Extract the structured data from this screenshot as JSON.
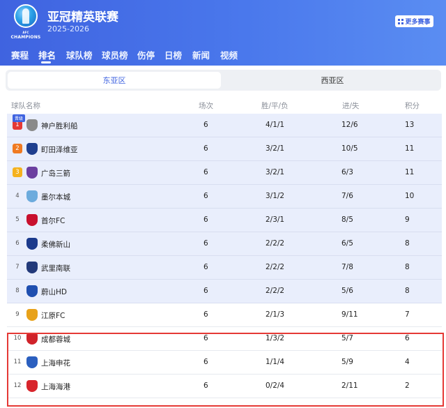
{
  "header": {
    "title": "亚冠精英联赛",
    "season": "2025-2026",
    "logo_text": "CHAMPIONS",
    "logo_small": "AFC",
    "more_label": "更多赛事"
  },
  "nav": [
    {
      "label": "赛程",
      "active": false
    },
    {
      "label": "排名",
      "active": true
    },
    {
      "label": "球队榜",
      "active": false
    },
    {
      "label": "球员榜",
      "active": false
    },
    {
      "label": "伤停",
      "active": false
    },
    {
      "label": "日榜",
      "active": false
    },
    {
      "label": "新闻",
      "active": false
    },
    {
      "label": "视频",
      "active": false
    }
  ],
  "zones": {
    "east": "东亚区",
    "west": "西亚区",
    "active": "east"
  },
  "table": {
    "headers": {
      "team": "球队名称",
      "played": "场次",
      "wdl": "胜/平/负",
      "goals": "进/失",
      "points": "积分"
    },
    "qualified_tag": "晋级",
    "rows": [
      {
        "rank": "1",
        "team": "神户胜利船",
        "played": "6",
        "wdl": "4/1/1",
        "goals": "12/6",
        "points": "13",
        "crest": "#8a8a8a"
      },
      {
        "rank": "2",
        "team": "町田泽维亚",
        "played": "6",
        "wdl": "3/2/1",
        "goals": "10/5",
        "points": "11",
        "crest": "#1f3f8f"
      },
      {
        "rank": "3",
        "team": "广岛三箭",
        "played": "6",
        "wdl": "3/2/1",
        "goals": "6/3",
        "points": "11",
        "crest": "#6b3fa0"
      },
      {
        "rank": "4",
        "team": "墨尔本城",
        "played": "6",
        "wdl": "3/1/2",
        "goals": "7/6",
        "points": "10",
        "crest": "#6cabdd"
      },
      {
        "rank": "5",
        "team": "首尔FC",
        "played": "6",
        "wdl": "2/3/1",
        "goals": "8/5",
        "points": "9",
        "crest": "#c8102e"
      },
      {
        "rank": "6",
        "team": "柔佛新山",
        "played": "6",
        "wdl": "2/2/2",
        "goals": "6/5",
        "points": "8",
        "crest": "#1b3a8c"
      },
      {
        "rank": "7",
        "team": "武里南联",
        "played": "6",
        "wdl": "2/2/2",
        "goals": "7/8",
        "points": "8",
        "crest": "#233a7a"
      },
      {
        "rank": "8",
        "team": "蔚山HD",
        "played": "6",
        "wdl": "2/2/2",
        "goals": "5/6",
        "points": "8",
        "crest": "#1f4fb0"
      },
      {
        "rank": "9",
        "team": "江原FC",
        "played": "6",
        "wdl": "2/1/3",
        "goals": "9/11",
        "points": "7",
        "crest": "#e8a21a"
      },
      {
        "rank": "10",
        "team": "成都蓉城",
        "played": "6",
        "wdl": "1/3/2",
        "goals": "5/7",
        "points": "6",
        "crest": "#d0232a"
      },
      {
        "rank": "11",
        "team": "上海申花",
        "played": "6",
        "wdl": "1/1/4",
        "goals": "5/9",
        "points": "4",
        "crest": "#2b5fbf"
      },
      {
        "rank": "12",
        "team": "上海海港",
        "played": "6",
        "wdl": "0/2/4",
        "goals": "2/11",
        "points": "2",
        "crest": "#d8252c"
      }
    ]
  },
  "colors": {
    "accent": "#3f63e0",
    "qualified_bg": "#e9eefc",
    "relegation_border": "#e53935",
    "rank1": "#e53935",
    "rank2": "#f07a21",
    "rank3": "#f5b21e"
  }
}
